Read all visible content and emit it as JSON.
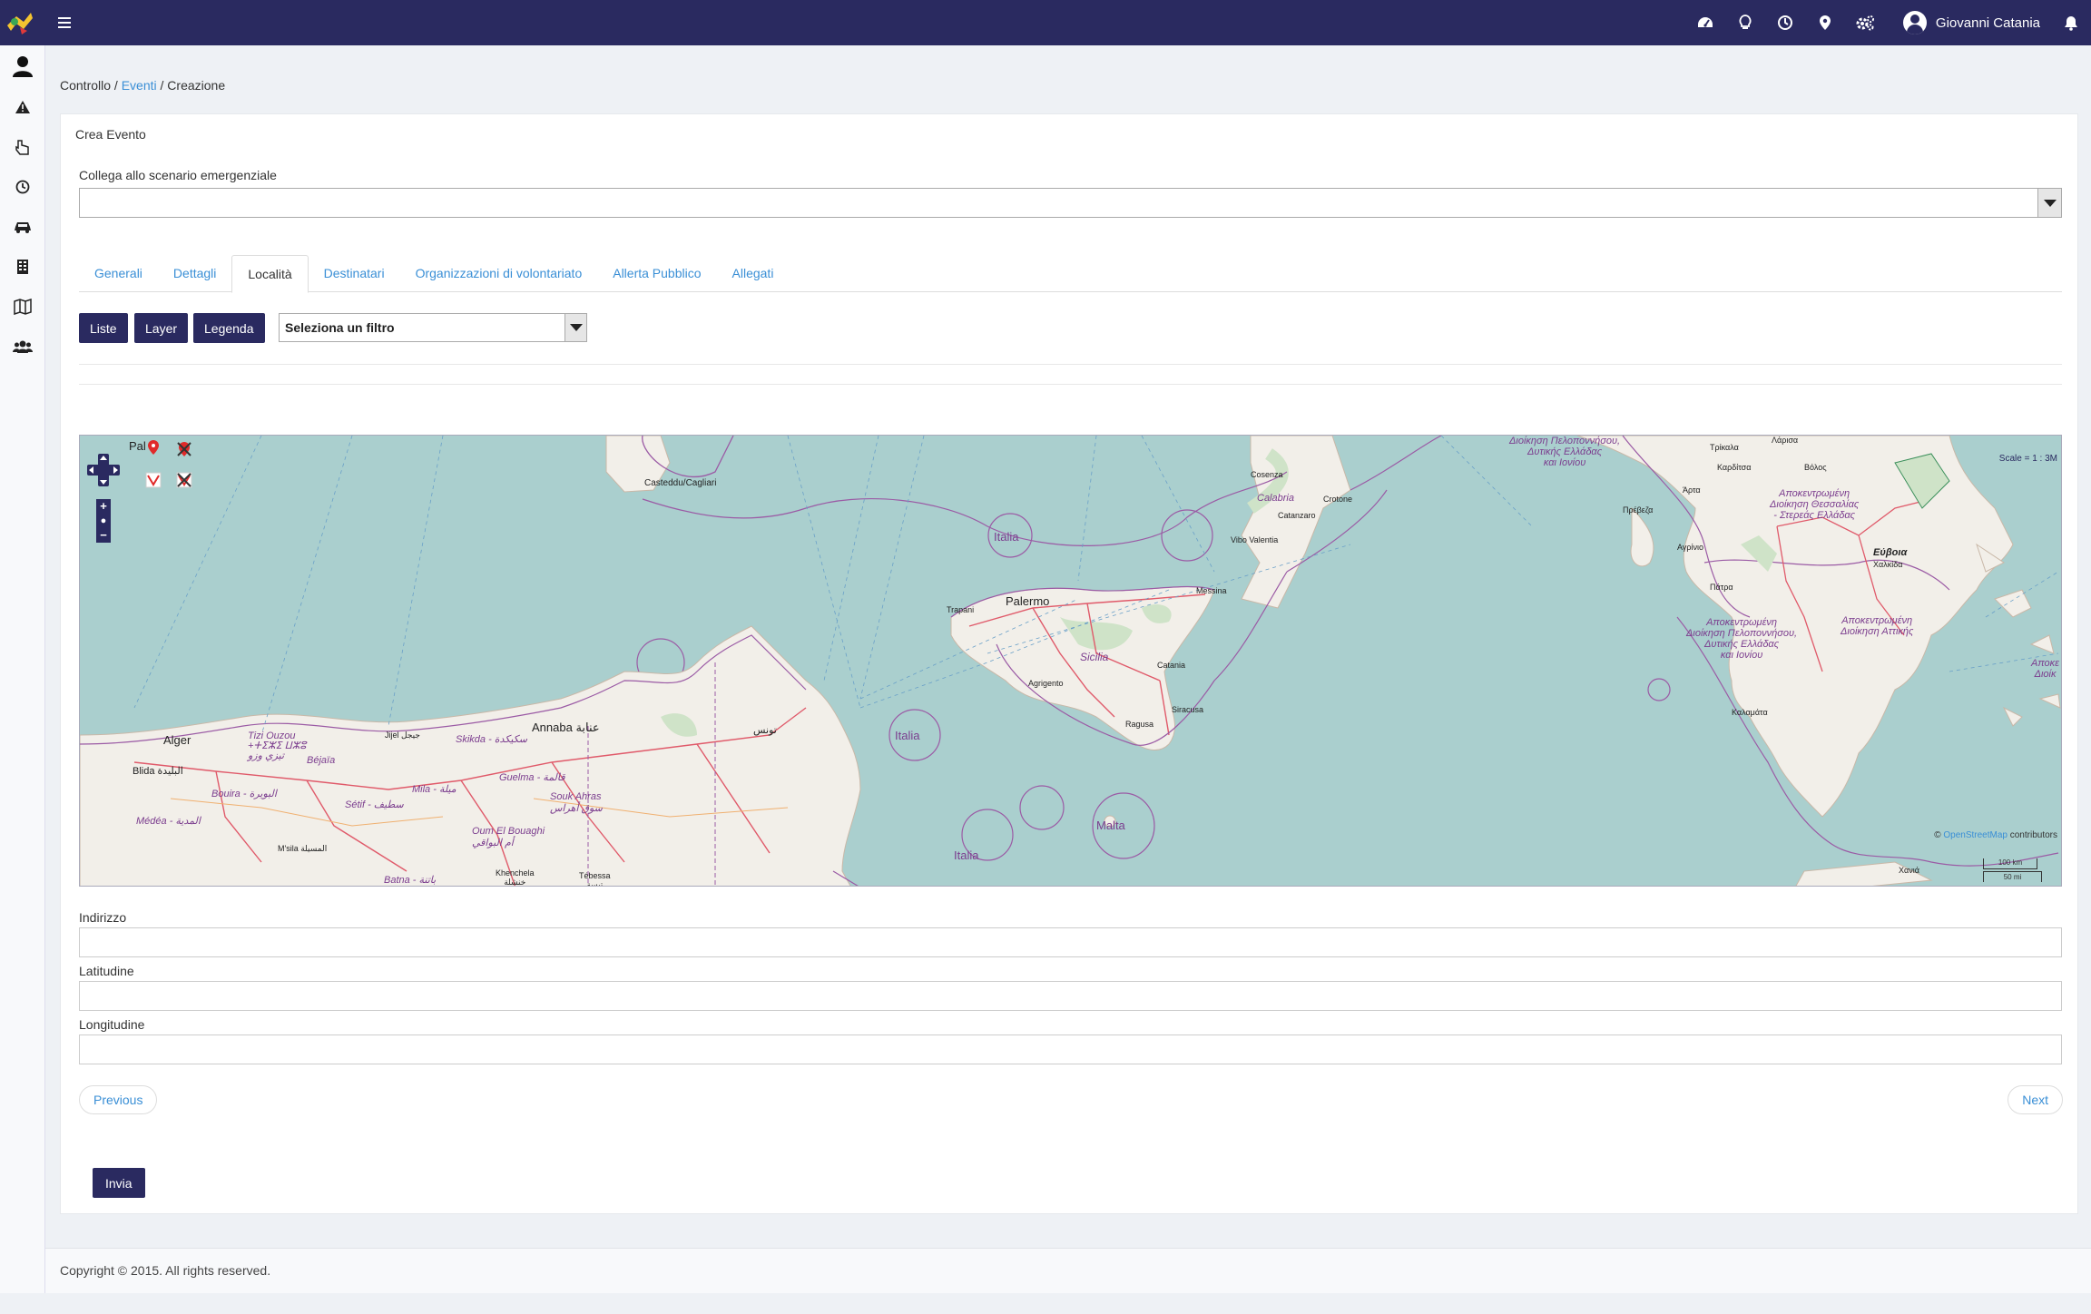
{
  "header": {
    "icons": [
      "dashboard-icon",
      "lightbulb-icon",
      "clock-icon",
      "map-marker-icon",
      "cogs-icon",
      "bell-icon"
    ],
    "user_name": "Giovanni Catania"
  },
  "sidebar": {
    "items": [
      "user-icon",
      "warning-icon",
      "hand-pointer-icon",
      "clock-icon",
      "car-icon",
      "building-icon",
      "map-icon",
      "users-icon"
    ]
  },
  "breadcrumb": {
    "root": "Controllo",
    "sep1": " / ",
    "link": "Eventi",
    "sep2": " / ",
    "current": "Creazione"
  },
  "panel": {
    "title": "Crea Evento",
    "scenario_label": "Collega allo scenario emergenziale",
    "scenario_value": ""
  },
  "tabs": [
    "Generali",
    "Dettagli",
    "Località",
    "Destinatari",
    "Organizzazioni di volontariato",
    "Allerta Pubblico",
    "Allegati"
  ],
  "active_tab": "Località",
  "map_toolbar": {
    "liste": "Liste",
    "layer": "Layer",
    "legenda": "Legenda",
    "filter_placeholder": "Seleziona un filtro"
  },
  "map": {
    "scale": "Scale = 1 : 3M",
    "attribution_prefix": "© ",
    "attribution_link": "OpenStreetMap",
    "attribution_suffix": " contributors",
    "scale_km": "100 km",
    "scale_mi": "50 mi",
    "labels": {
      "pal": "Pal",
      "cagliari": "Casteddu/Cagliari",
      "italia1": "Italia",
      "italia2": "Italia",
      "italia3": "Italia",
      "palermo": "Palermo",
      "trapani": "Trapani",
      "sicilia": "Sicilia",
      "agrigento": "Agrigento",
      "catania": "Catania",
      "siracusa": "Siracusa",
      "ragusa": "Ragusa",
      "messina": "Messina",
      "malta": "Malta",
      "cosenza": "Cosenza",
      "calabria": "Calabria",
      "catanzaro": "Catanzaro",
      "crotone": "Crotone",
      "vibo": "Vibo Valentia",
      "alger": "Alger",
      "blida": "Blida البليدة",
      "annaba": "Annaba عنابة",
      "tunis": "تونس",
      "skikda": "Skikda - سكيكدة",
      "guelma": "Guelma - قالمة",
      "souk_ahras": "Souk Ahras\nسوق أهراس",
      "bejaia": "Béjaïa",
      "setif": "Sétif - سطيف",
      "batna": "Batna - باتنة",
      "khenchela": "Khenchela\nخنشلة",
      "tebessa": "Tébessa\nتبسة",
      "mila": "Mila - ميلة",
      "oum": "Oum El Bouaghi\nأم البواقي",
      "msila": "M'sila المسيلة",
      "medea": "Médéa - المدية",
      "tizi": "Tizi Ouzou\n+ⵜⵉⵣⵉ ⵡⵣⵓ\nتيزي وزو",
      "bouira": "Bouira - البويرة",
      "jijel": "Jijel جيجل",
      "larisa": "Λάρισα",
      "trikala": "Τρίκαλα",
      "volos": "Βόλος",
      "karditsa": "Καρδίτσα",
      "arta": "Άρτα",
      "preveza": "Πρέβεζα",
      "agrinio": "Αγρίνιο",
      "evia": "Εύβοια",
      "chalkida": "Χαλκίδα",
      "patra": "Πάτρα",
      "kalamata": "Καλαμάτα",
      "chania": "Χανιά",
      "greek_region1": "Διοίκηση Πελοποννήσου,\nΔυτικής Ελλάδας\nκαι Ιονίου",
      "greek_region2": "Αποκεντρωμένη\nΔιοίκηση Θεσσαλίας\n- Στερεάς Ελλάδας",
      "greek_region3": "Αποκεντρωμένη\nΔιοίκηση Πελοποννήσου,\nΔυτικής Ελλάδας\nκαι Ιονίου",
      "greek_region4": "Αποκεντρωμένη\nΔιοίκηση Αττικής",
      "greek_region5": "Αποκε\nΔιοίκ"
    }
  },
  "fields": {
    "indirizzo_label": "Indirizzo",
    "indirizzo_value": "",
    "latitudine_label": "Latitudine",
    "latitudine_value": "",
    "longitudine_label": "Longitudine",
    "longitudine_value": ""
  },
  "nav": {
    "previous": "Previous",
    "next": "Next",
    "submit": "Invia"
  },
  "footer": {
    "copyright": "Copyright © 2015. All rights reserved."
  },
  "colors": {
    "primary": "#2a2a60",
    "link": "#3a8fd6",
    "sea": "#aacfce",
    "land": "#f2efe9",
    "border_purple": "#9b5ba5"
  }
}
